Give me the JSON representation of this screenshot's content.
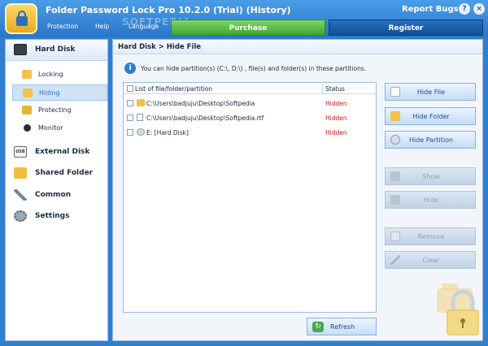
{
  "window": {
    "title": "Folder Password Lock Pro 10.2.0 (Trial) (History)",
    "report_bugs": "Report Bugs",
    "help_glyph": "?",
    "close_glyph": "×",
    "watermark": "SOFTPEDIA"
  },
  "menu": {
    "items": [
      "Protection",
      "Help",
      "Language"
    ]
  },
  "header_buttons": {
    "purchase": "Purchase",
    "register": "Register"
  },
  "sidebar": {
    "categories": [
      {
        "label": "Hard Disk",
        "icon": "hard-disk-icon"
      },
      {
        "label": "External Disk",
        "icon": "usb-drive-icon"
      },
      {
        "label": "Shared Folder",
        "icon": "shared-folder-icon"
      },
      {
        "label": "Common",
        "icon": "tools-icon"
      },
      {
        "label": "Settings",
        "icon": "gear-icon"
      }
    ],
    "sub_items": [
      {
        "label": "Locking",
        "icon": "lock-folder-icon"
      },
      {
        "label": "Hiding",
        "icon": "hide-folder-icon"
      },
      {
        "label": "Protecting",
        "icon": "shield-folder-icon"
      },
      {
        "label": "Monitor",
        "icon": "monitor-icon"
      }
    ],
    "active": "Hiding"
  },
  "main": {
    "breadcrumb": "Hard Disk > Hide File",
    "info_glyph": "i",
    "info_text": "You can hide partition(s) (C:\\, D:\\) , file(s) and folder(s) in these partitions.",
    "table": {
      "header_file": "List of file/folder/partition",
      "header_status": "Status",
      "rows": [
        {
          "path": "C:\\Users\\badjuju\\Desktop\\Softpedia",
          "status": "Hidden",
          "icon": "folder-icon"
        },
        {
          "path": "C:\\Users\\badjuju\\Desktop\\Softpedia.rtf",
          "status": "Hidden",
          "icon": "file-icon"
        },
        {
          "path": "E: [Hard Disk]",
          "status": "Hidden",
          "icon": "disk-icon"
        }
      ]
    },
    "refresh": "Refresh",
    "actions": {
      "hide_file": "Hide File",
      "hide_folder": "Hide Folder",
      "hide_partition": "Hide Partition",
      "show": "Show",
      "hide": "Hide",
      "remove": "Remove",
      "clear": "Clear"
    }
  },
  "colors": {
    "accent": "#2f7fd1",
    "purchase_green": "#3fa52c",
    "register_blue": "#124f96",
    "status_red": "#d9141b"
  }
}
